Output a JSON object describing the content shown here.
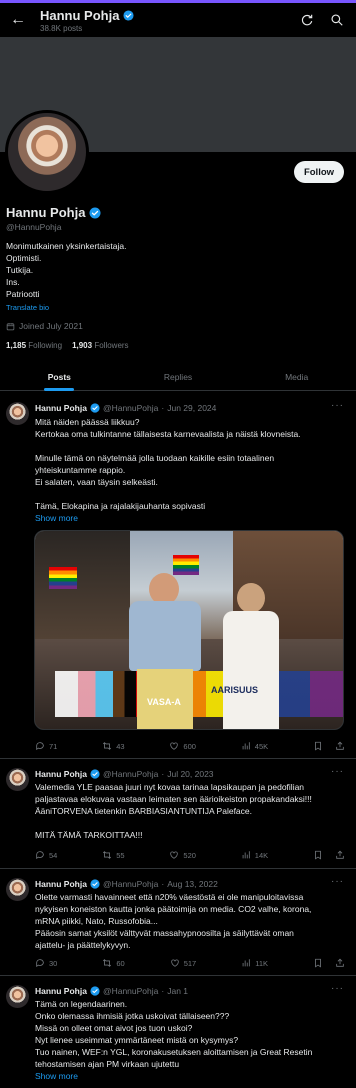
{
  "header": {
    "back_icon": "arrow-left-icon",
    "name": "Hannu Pohja",
    "posts_count": "38.8K posts",
    "icons": [
      "refresh-icon",
      "search-icon"
    ]
  },
  "profile": {
    "follow_label": "Follow",
    "name": "Hannu Pohja",
    "handle": "@HannuPohja",
    "bio": [
      "Monimutkainen yksinkertaistaja.",
      "Optimisti.",
      "Tutkija.",
      "Ins.",
      "Patriootti"
    ],
    "translate_label": "Translate bio",
    "joined": "Joined July 2021",
    "following_count": "1,185",
    "following_label": "Following",
    "followers_count": "1,903",
    "followers_label": "Followers"
  },
  "tabs": [
    {
      "label": "Posts",
      "active": true
    },
    {
      "label": "Replies",
      "active": false
    },
    {
      "label": "Media",
      "active": false
    }
  ],
  "colors": {
    "accent": "#1d9bf0",
    "verified": "#1d9bf0",
    "background": "#000000",
    "text": "#e7e9ea",
    "muted": "#71767b"
  },
  "tweets": [
    {
      "name": "Hannu Pohja",
      "handle": "@HannuPohja",
      "date": "Jun 29, 2024",
      "lines": [
        "Mitä näiden päässä liikkuu?",
        "Kertokaa oma tulkintanne tällaisesta karnevaalista ja näistä klovneista.",
        "",
        "Minulle tämä on näytelmää jolla tuodaan kaikille esiin totaalinen",
        "yhteiskuntamme rappio.",
        "Ei salaten, vaan täysin selkeästi.",
        "",
        "Tämä, Elokapina ja rajalakijauhanta sopivasti"
      ],
      "show_more": "Show more",
      "media_text_1": "AARISUUS",
      "media_text_2": "VASA-A",
      "replies": "71",
      "reposts": "43",
      "likes": "600",
      "views": "45K"
    },
    {
      "name": "Hannu Pohja",
      "handle": "@HannuPohja",
      "date": "Jul 20, 2023",
      "lines": [
        "Valemedia YLE  paasaa juuri nyt kovaa tarinaa lapsikaupan ja pedofilian",
        "paljastavaa elokuvaa vastaan leimaten sen äärioikeiston propakandaksi!!!",
        "ÄäniTORVENA tietenkin BARBIASIANTUNTIJA Paleface.",
        "",
        "MITÄ TÄMÄ TARKOITTAA!!!"
      ],
      "replies": "54",
      "reposts": "55",
      "likes": "520",
      "views": "14K"
    },
    {
      "name": "Hannu Pohja",
      "handle": "@HannuPohja",
      "date": "Aug 13, 2022",
      "lines": [
        "Olette varmasti havainneet että n20% väestöstä ei ole manipuloitavissa",
        "nykyisen koneiston kautta jonka päätoimija on media. CO2 valhe, korona,",
        "mRNA piikki, Nato, Russofobia...",
        "Pääosin samat yksilöt välttyvät massahypnoosilta ja säilyttävät oman",
        "ajattelu- ja päättelykyvyn."
      ],
      "replies": "30",
      "reposts": "60",
      "likes": "517",
      "views": "11K"
    },
    {
      "name": "Hannu Pohja",
      "handle": "@HannuPohja",
      "date": "Jan 1",
      "lines": [
        "Tämä on legendaarinen.",
        "Onko olemassa ihmisiä jotka uskoivat tällaiseen???",
        "Missä on olleet omat aivot jos tuon uskoi?",
        "Nyt lienee useimmat ymmärtäneet mistä on kysymys?",
        "Tuo nainen, WEF:n YGL,  koronakusetuksen aloittamisen ja Great Resetin",
        "tehostamisen ajan PM virkaan ujutettu"
      ],
      "show_more": "Show more"
    }
  ]
}
